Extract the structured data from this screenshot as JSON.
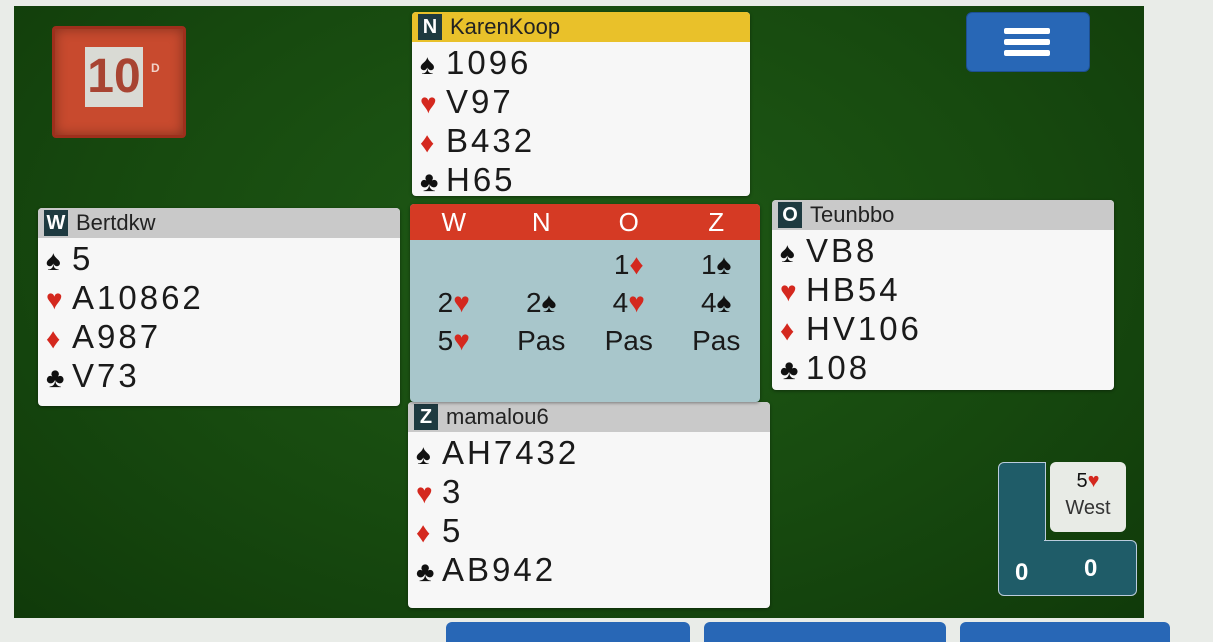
{
  "board": {
    "number": "10",
    "dealer": "D"
  },
  "hands": {
    "north": {
      "seat": "N",
      "player": "KarenKoop",
      "spades": "1096",
      "hearts": "V97",
      "diamonds": "B432",
      "clubs": "H65"
    },
    "west": {
      "seat": "W",
      "player": "Bertdkw",
      "spades": "5",
      "hearts": "A10862",
      "diamonds": "A987",
      "clubs": "V73"
    },
    "east": {
      "seat": "O",
      "player": "Teunbbo",
      "spades": "VB8",
      "hearts": "HB54",
      "diamonds": "HV106",
      "clubs": "108"
    },
    "south": {
      "seat": "Z",
      "player": "mamalou6",
      "spades": "AH7432",
      "hearts": "3",
      "diamonds": "5",
      "clubs": "AB942"
    }
  },
  "suit_symbols": {
    "spade": "♠",
    "heart": "♥",
    "diamond": "♦",
    "club": "♣"
  },
  "bidding": {
    "headers": [
      "W",
      "N",
      "O",
      "Z"
    ],
    "rows": [
      [
        {
          "level": "",
          "suit": ""
        },
        {
          "level": "",
          "suit": ""
        },
        {
          "level": "1",
          "suit": "diamond"
        },
        {
          "level": "1",
          "suit": "spade"
        }
      ],
      [
        {
          "level": "2",
          "suit": "heart"
        },
        {
          "level": "2",
          "suit": "spade"
        },
        {
          "level": "4",
          "suit": "heart"
        },
        {
          "level": "4",
          "suit": "spade"
        }
      ],
      [
        {
          "level": "5",
          "suit": "heart"
        },
        {
          "level": "Pas",
          "suit": ""
        },
        {
          "level": "Pas",
          "suit": ""
        },
        {
          "level": "Pas",
          "suit": ""
        }
      ]
    ]
  },
  "contract": {
    "level": "5",
    "suit": "heart",
    "declarer": "West"
  },
  "score": {
    "left": "0",
    "right": "0"
  },
  "colors": {
    "felt": "#174a0f",
    "north_header": "#e9c12a",
    "bid_header": "#d53a24",
    "bid_bg": "#a8c6cb",
    "menu": "#2867b6"
  }
}
